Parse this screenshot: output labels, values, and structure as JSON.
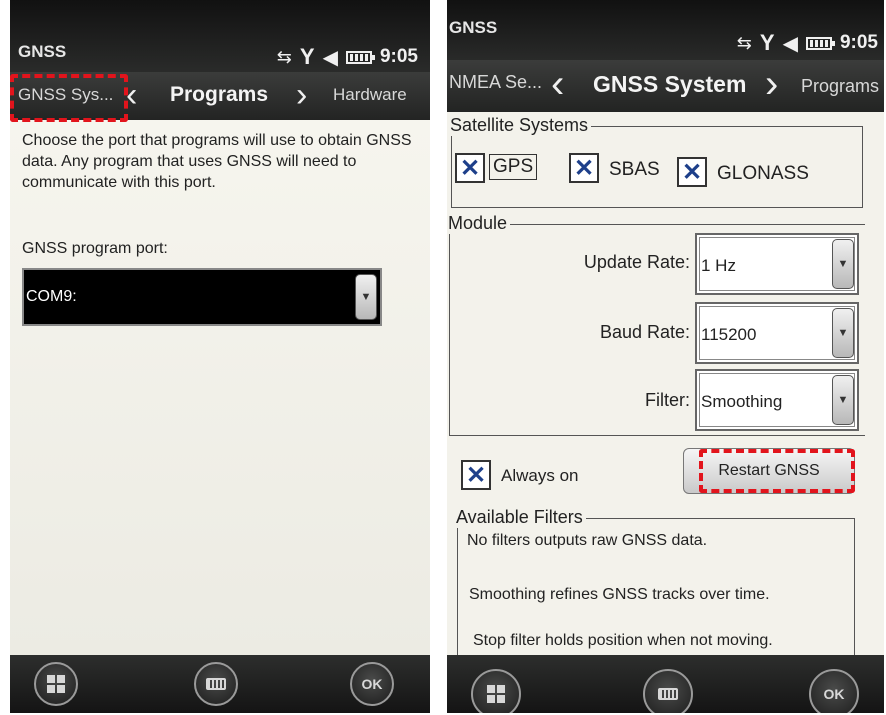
{
  "left": {
    "app_title": "GNSS",
    "clock": "9:05",
    "tabs": {
      "prev": "GNSS Sys...",
      "current": "Programs",
      "next": "Hardware"
    },
    "description": "Choose the port that programs will use to obtain GNSS data.  Any program that uses GNSS will need to communicate with this port.",
    "port_label": "GNSS program port:",
    "port_value": "COM9:",
    "ok_label": "OK"
  },
  "right": {
    "app_title": "GNSS",
    "clock": "9:05",
    "tabs": {
      "prev": "NMEA Se...",
      "current": "GNSS System",
      "next": "Programs"
    },
    "satellite_systems": {
      "legend": "Satellite Systems",
      "items": [
        {
          "label": "GPS",
          "checked": true
        },
        {
          "label": "SBAS",
          "checked": true
        },
        {
          "label": "GLONASS",
          "checked": true
        }
      ]
    },
    "module": {
      "legend": "Module",
      "update_rate_label": "Update Rate:",
      "update_rate_value": "1 Hz",
      "baud_rate_label": "Baud Rate:",
      "baud_rate_value": "115200",
      "filter_label": "Filter:",
      "filter_value": "Smoothing"
    },
    "always_on_label": "Always on",
    "restart_label": "Restart GNSS",
    "available_filters": {
      "legend": "Available Filters",
      "lines": [
        "No filters outputs raw GNSS data.",
        "Smoothing refines GNSS tracks over time.",
        "Stop filter holds position when not moving."
      ]
    },
    "ok_label": "OK"
  },
  "colors": {
    "highlight": "#e2141c",
    "check": "#1d3f8a"
  }
}
